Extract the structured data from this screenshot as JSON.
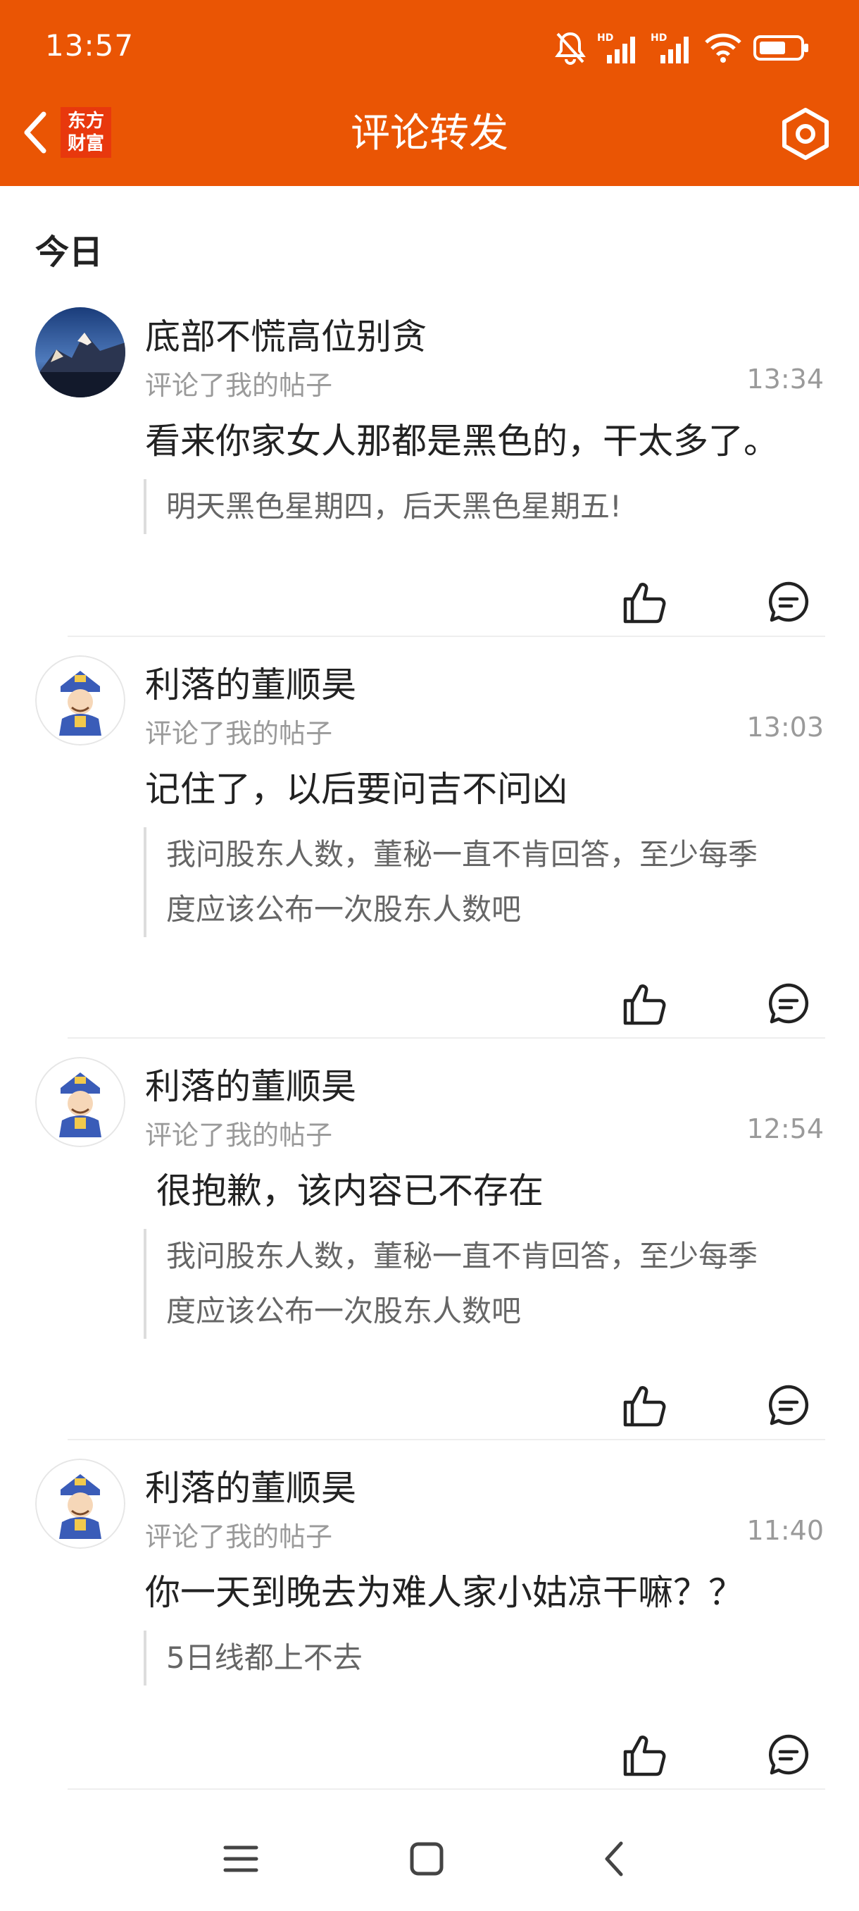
{
  "status_bar": {
    "time": "13:57",
    "icons": [
      "mute-bell-icon",
      "hd-signal-icon",
      "hd-signal-icon",
      "wifi-icon",
      "battery-icon"
    ]
  },
  "header": {
    "title": "评论转发",
    "logo_text": "东方财富",
    "logo_line1": "东方",
    "logo_line2": "财富",
    "back_icon": "back-chevron-icon",
    "settings_icon": "gear-icon"
  },
  "section": {
    "label": "今日"
  },
  "items": [
    {
      "username": "底部不慌高位别贪",
      "action": "评论了我的帖子",
      "time": "13:34",
      "comment": "看来你家女人那都是黑色的，干太多了。",
      "quote_lines": [
        "明天黑色星期四，后天黑色星期五!"
      ]
    },
    {
      "username": "利落的董顺昊",
      "action": "评论了我的帖子",
      "time": "13:03",
      "comment": "记住了，以后要问吉不问凶",
      "quote_lines": [
        "我问股东人数，董秘一直不肯回答，至少每季",
        "度应该公布一次股东人数吧"
      ]
    },
    {
      "username": "利落的董顺昊",
      "action": "评论了我的帖子",
      "time": "12:54",
      "comment": " 很抱歉，该内容已不存在",
      "quote_lines": [
        "我问股东人数，董秘一直不肯回答，至少每季",
        "度应该公布一次股东人数吧"
      ]
    },
    {
      "username": "利落的董顺昊",
      "action": "评论了我的帖子",
      "time": "11:40",
      "comment": "你一天到晚去为难人家小姑凉干嘛？？",
      "quote_lines": [
        "5日线都上不去"
      ]
    }
  ],
  "nav": {
    "icons": [
      "menu-icon",
      "home-square-icon",
      "back-triangle-icon"
    ]
  },
  "colors": {
    "brand": "#EA5504",
    "text": "#222222",
    "muted": "#9a9a9a"
  }
}
